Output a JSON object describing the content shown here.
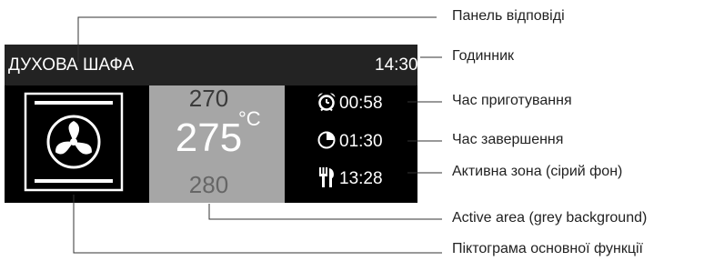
{
  "panel": {
    "title": "ДУХОВА ШАФА",
    "clock": "14:30",
    "temperature": {
      "upper": "270",
      "current": "275",
      "unit": "°C",
      "lower": "280"
    },
    "info": [
      {
        "icon": "alarm-clock-icon",
        "value": "00:58"
      },
      {
        "icon": "half-circle-clock-icon",
        "value": "01:30"
      },
      {
        "icon": "fork-knife-icon",
        "value": "13:28"
      }
    ],
    "main_function_icon": "fan-icon"
  },
  "callouts": {
    "response_panel": "Панель відповіді",
    "clock": "Годинник",
    "cooking_time": "Час приготування",
    "end_time": "Час завершення",
    "active_zone": "Активна зона (сірий фон)",
    "active_area": "Active area (grey background)",
    "main_function_icon": "Піктограма основної функції"
  },
  "colors": {
    "panel_bg": "#000000",
    "header_bg": "#232323",
    "active_area_bg": "#a6a6a6",
    "text": "#ffffff"
  }
}
